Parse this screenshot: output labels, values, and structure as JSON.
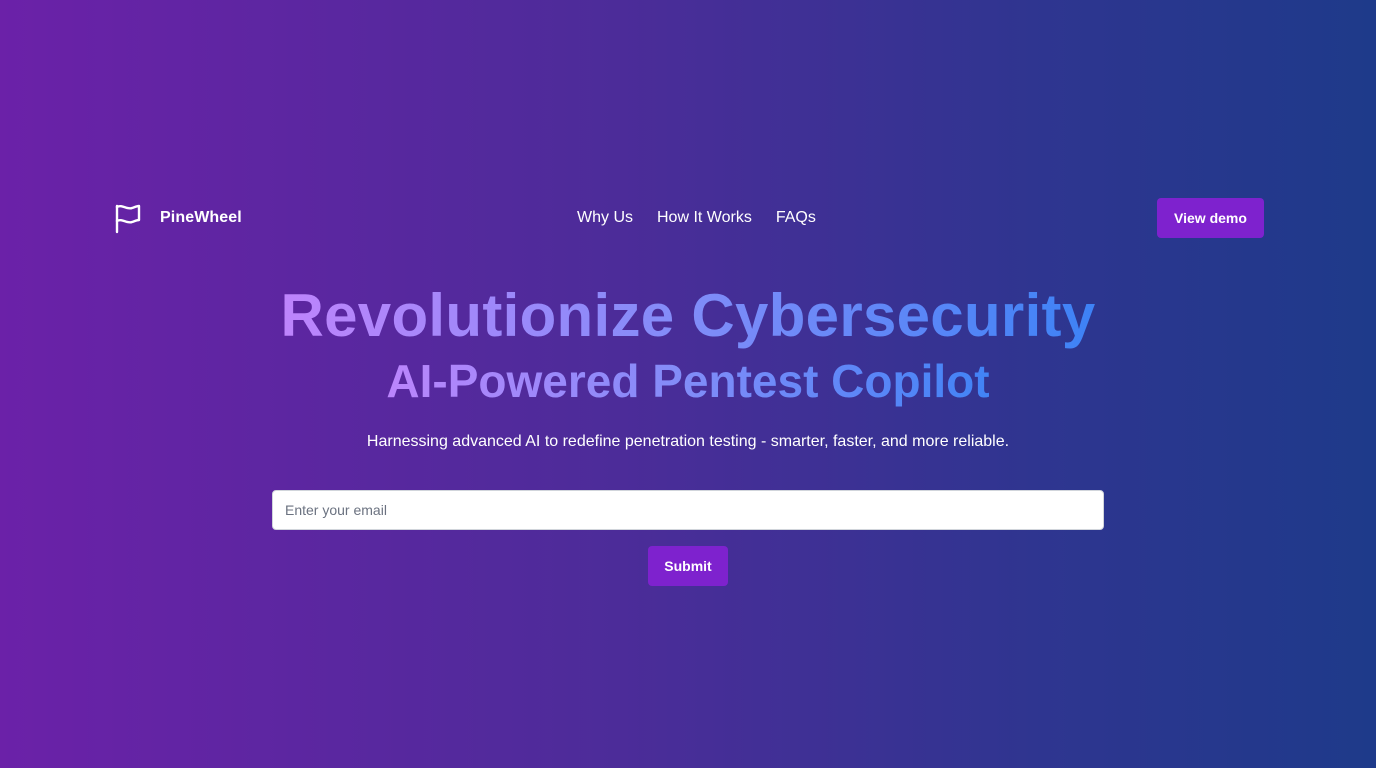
{
  "brand": {
    "name": "PineWheel",
    "icon": "flag-icon"
  },
  "nav": {
    "items": [
      {
        "label": "Why Us"
      },
      {
        "label": "How It Works"
      },
      {
        "label": "FAQs"
      }
    ],
    "cta_label": "View demo"
  },
  "hero": {
    "headline": "Revolutionize Cybersecurity",
    "subheadline": "AI-Powered Pentest Copilot",
    "tagline": "Harnessing advanced AI to redefine penetration testing - smarter, faster, and more reliable."
  },
  "signup": {
    "email_placeholder": "Enter your email",
    "email_value": "",
    "submit_label": "Submit"
  },
  "colors": {
    "background_start": "#6b21a8",
    "background_end": "#1e3a8a",
    "button": "#7e22ce",
    "gradient_text_start": "#c084fc",
    "gradient_text_mid": "#818cf8",
    "gradient_text_end": "#3b82f6"
  }
}
